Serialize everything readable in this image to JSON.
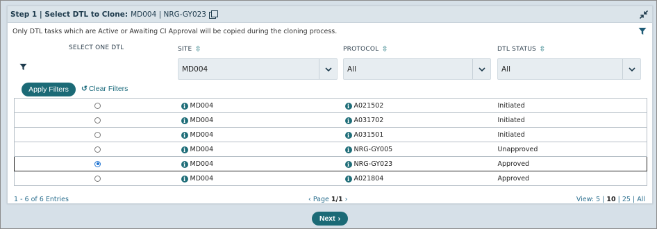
{
  "header": {
    "step_label": "Step 1 | Select DTL to Clone:",
    "protocol_codes": "MD004 | NRG-GY023"
  },
  "notice": "Only DTL tasks which are Active or Awaiting CI Approval will be copied during the cloning process.",
  "columns": {
    "select": "SELECT ONE DTL",
    "site": "SITE",
    "protocol": "PROTOCOL",
    "status": "DTL STATUS"
  },
  "filters": {
    "site": "MD004",
    "protocol": "All",
    "status": "All"
  },
  "buttons": {
    "apply": "Apply Filters",
    "clear": "Clear Filters",
    "next": "Next"
  },
  "rows": [
    {
      "site": "MD004",
      "protocol": "A021502",
      "status": "Initiated",
      "selected": false
    },
    {
      "site": "MD004",
      "protocol": "A031702",
      "status": "Initiated",
      "selected": false
    },
    {
      "site": "MD004",
      "protocol": "A031501",
      "status": "Initiated",
      "selected": false
    },
    {
      "site": "MD004",
      "protocol": "NRG-GY005",
      "status": "Unapproved",
      "selected": false
    },
    {
      "site": "MD004",
      "protocol": "NRG-GY023",
      "status": "Approved",
      "selected": true
    },
    {
      "site": "MD004",
      "protocol": "A021804",
      "status": "Approved",
      "selected": false
    }
  ],
  "pagination": {
    "entries": "1 - 6 of 6 Entries",
    "page_prefix": "Page",
    "page_value": "1/1",
    "view_label": "View:",
    "view_5": "5",
    "view_10": "10",
    "view_25": "25",
    "view_all": "All"
  },
  "colors": {
    "accent": "#1b6a76",
    "header_bg": "#dbe4ea",
    "link": "#2a6e8e"
  },
  "icons": [
    "copy-icon",
    "collapse-icon",
    "filter-icon",
    "sort-icon",
    "chevron-down-icon",
    "refresh-icon",
    "info-icon",
    "chevron-left-icon",
    "chevron-right-icon"
  ]
}
